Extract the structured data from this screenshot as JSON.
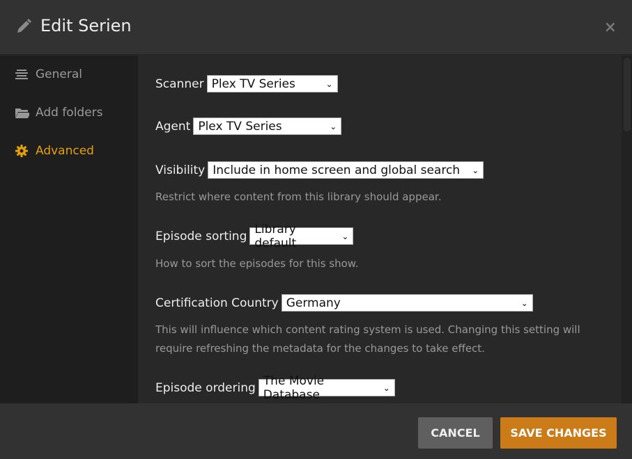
{
  "header": {
    "title": "Edit Serien",
    "close": "×"
  },
  "sidebar": {
    "items": [
      {
        "label": "General",
        "icon": "list-icon"
      },
      {
        "label": "Add folders",
        "icon": "folder-icon"
      },
      {
        "label": "Advanced",
        "icon": "gear-icon",
        "active": true
      }
    ]
  },
  "fields": {
    "scanner": {
      "label": "Scanner",
      "value": "Plex TV Series"
    },
    "agent": {
      "label": "Agent",
      "value": "Plex TV Series"
    },
    "visibility": {
      "label": "Visibility",
      "value": "Include in home screen and global search",
      "help": "Restrict where content from this library should appear."
    },
    "episode_sorting": {
      "label": "Episode sorting",
      "value": "Library default",
      "help": "How to sort the episodes for this show."
    },
    "cert_country": {
      "label": "Certification Country",
      "value": "Germany",
      "help": "This will influence which content rating system is used. Changing this setting will require refreshing the metadata for the changes to take effect."
    },
    "episode_ordering": {
      "label": "Episode ordering",
      "value": "The Movie Database"
    }
  },
  "footer": {
    "cancel": "CANCEL",
    "save": "SAVE CHANGES"
  },
  "colors": {
    "accent": "#e5a00d",
    "save": "#cc7b19"
  }
}
